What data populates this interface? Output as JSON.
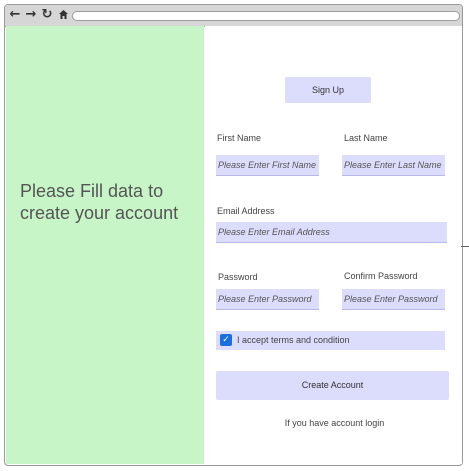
{
  "browser": {
    "back_icon": "arrow-left",
    "forward_icon": "arrow-right",
    "reload_icon": "reload",
    "home_icon": "home",
    "address": ""
  },
  "left_panel": {
    "message": "Please Fill data to create your account"
  },
  "form": {
    "signup_label": "Sign Up",
    "first_name": {
      "label": "First Name",
      "placeholder": "Please Enter First Name"
    },
    "last_name": {
      "label": "Last Name",
      "placeholder": "Please Enter Last Name"
    },
    "email": {
      "label": "Email Address",
      "placeholder": "Please Enter Email Address"
    },
    "password": {
      "label": "Password",
      "placeholder": "Please Enter Password"
    },
    "confirm_password": {
      "label": "Confirm Password",
      "placeholder": "Please Enter Password"
    },
    "terms": {
      "label": "I accept terms and condition",
      "checked": true
    },
    "create_label": "Create Account",
    "login_text": "If you have account login"
  },
  "colors": {
    "left_bg": "#c7f5c7",
    "field_bg": "#dcdcfc",
    "checkbox": "#1a6fe0"
  }
}
